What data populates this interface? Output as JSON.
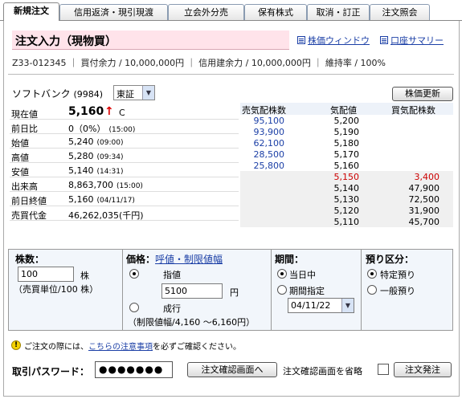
{
  "tabs": [
    "新規注文",
    "信用返済・現引現渡",
    "立会外分売",
    "保有株式",
    "取消・訂正",
    "注文照会"
  ],
  "page": {
    "title": "注文入力（現物買）",
    "links": {
      "chart_window": "株価ウィンドウ",
      "account_summary": "口座サマリー"
    }
  },
  "account": {
    "summary_line": "Z33-012345 ｜ 買付余力 / 10,000,000円 ｜ 信用建余力 / 10,000,000円 ｜ 維持率 / 100%"
  },
  "stock": {
    "name": "ソフトバンク",
    "code": "(9984)",
    "market": "東証",
    "refresh_button": "株価更新"
  },
  "quote": {
    "current": {
      "label": "現在値",
      "value": "5,160",
      "arrow": "↑",
      "mark": "C"
    },
    "change": {
      "label": "前日比",
      "value": "0（0%）",
      "time": "(15:00)"
    },
    "open": {
      "label": "始値",
      "value": "5,240",
      "time": "(09:00)"
    },
    "high": {
      "label": "高値",
      "value": "5,280",
      "time": "(09:34)"
    },
    "low": {
      "label": "安値",
      "value": "5,140",
      "time": "(14:31)"
    },
    "volume": {
      "label": "出来高",
      "value": "8,863,700",
      "time": "(15:00)"
    },
    "prev_close": {
      "label": "前日終値",
      "value": "5,160",
      "time": "(04/11/17)"
    },
    "turnover": {
      "label": "売買代金",
      "value": "46,262,035(千円)"
    }
  },
  "board": {
    "headers": {
      "sell": "売気配株数",
      "price": "気配値",
      "buy": "買気配株数"
    },
    "colors": {
      "sell": "#1b3fa6",
      "current": "#cc0000",
      "normal": "#000000"
    },
    "rows": [
      {
        "sell": "95,100",
        "price": "5,200",
        "buy": ""
      },
      {
        "sell": "93,900",
        "price": "5,190",
        "buy": ""
      },
      {
        "sell": "62,100",
        "price": "5,180",
        "buy": ""
      },
      {
        "sell": "28,500",
        "price": "5,170",
        "buy": ""
      },
      {
        "sell": "25,800",
        "price": "5,160",
        "buy": ""
      },
      {
        "sell": "",
        "price": "5,150",
        "buy": "3,400"
      },
      {
        "sell": "",
        "price": "5,140",
        "buy": "47,900"
      },
      {
        "sell": "",
        "price": "5,130",
        "buy": "72,500"
      },
      {
        "sell": "",
        "price": "5,120",
        "buy": "31,900"
      },
      {
        "sell": "",
        "price": "5,110",
        "buy": "45,700"
      }
    ]
  },
  "order": {
    "qty_title": "株数：",
    "qty_value": "100",
    "qty_unit": "株",
    "qty_note": "（売買単位/100 株）",
    "price_title": "価格：",
    "price_link": "呼値・制限値幅",
    "limit_label": "指値",
    "limit_value": "5100",
    "yen": "円",
    "market_label": "成行",
    "price_range": "（制限値幅/4,160 ～6,160円）",
    "period_title": "期間：",
    "period_today": "当日中",
    "period_specified": "期間指定",
    "period_date": "04/11/22",
    "custody_title": "預り区分：",
    "custody_specific": "特定預り",
    "custody_general": "一般預り"
  },
  "notice": {
    "prefix": "ご注文の際には、",
    "link": "こちらの注意事項",
    "suffix": "を必ずご確認ください。"
  },
  "footer": {
    "password_label": "取引パスワード：",
    "password_value": "●●●●●●●",
    "confirm_button": "注文確認画面へ",
    "skip_label": "注文確認画面を省略",
    "submit_button": "注文発注"
  }
}
